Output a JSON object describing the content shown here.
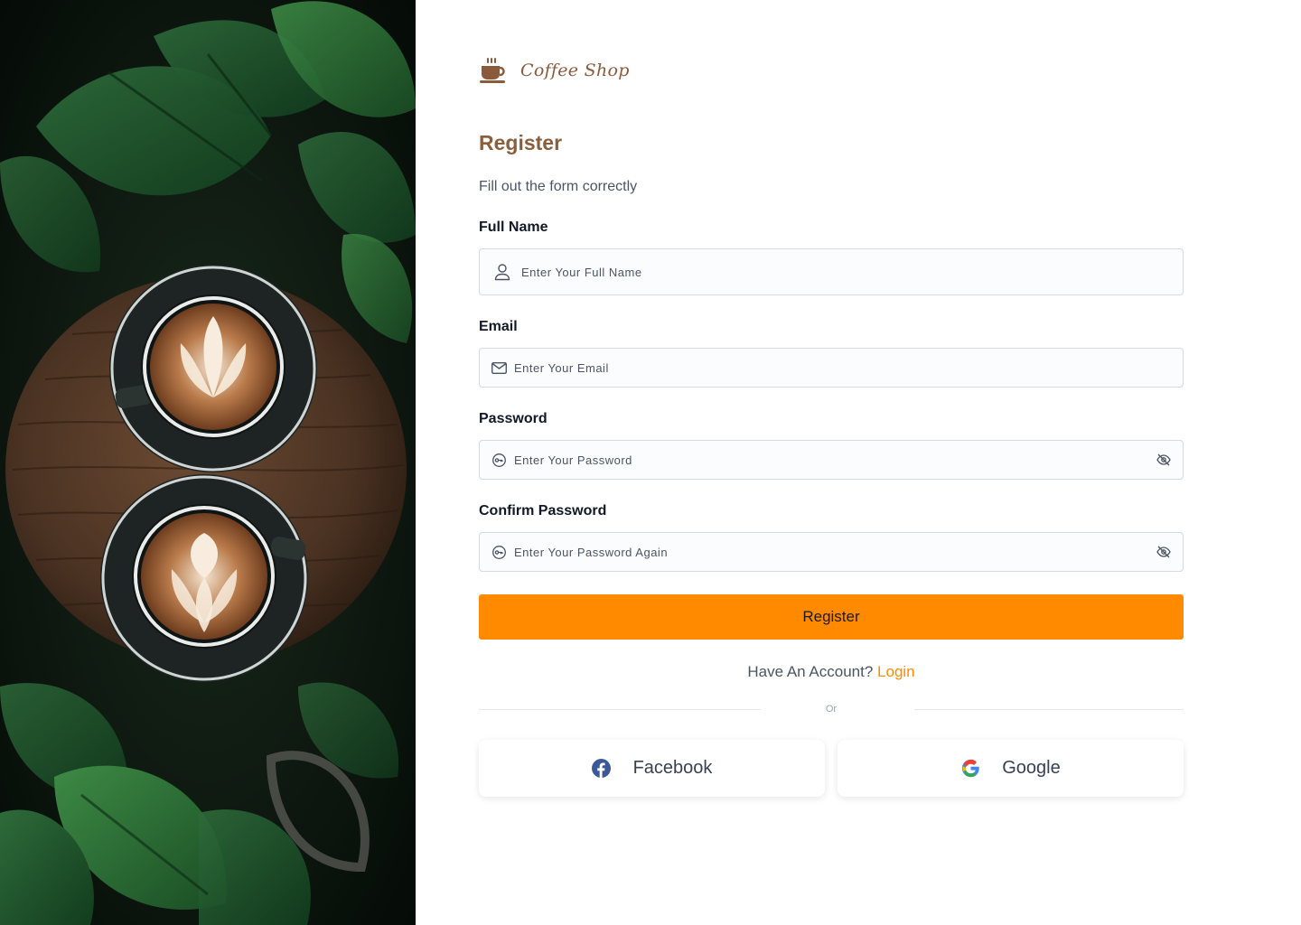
{
  "brand": {
    "name": "Coffee Shop",
    "icon": "coffee-cup-icon",
    "color": "#8a5a3c"
  },
  "form": {
    "title": "Register",
    "subtitle": "Fill out the form correctly",
    "fields": {
      "full_name": {
        "label": "Full Name",
        "placeholder": "Enter Your Full Name",
        "icon": "user-icon"
      },
      "email": {
        "label": "Email",
        "placeholder": "Enter Your Email",
        "icon": "mail-icon"
      },
      "password": {
        "label": "Password",
        "placeholder": "Enter Your Password",
        "icon": "key-icon",
        "toggle_icon": "eye-off-icon"
      },
      "confirm_password": {
        "label": "Confirm Password",
        "placeholder": "Enter Your Password Again",
        "icon": "key-icon",
        "toggle_icon": "eye-off-icon"
      }
    },
    "submit_label": "Register",
    "have_account_text": "Have An Account?",
    "login_link": "Login",
    "or_text": "Or"
  },
  "social": {
    "facebook": {
      "label": "Facebook",
      "icon": "facebook-icon"
    },
    "google": {
      "label": "Google",
      "icon": "google-icon"
    }
  },
  "colors": {
    "accent": "#ff8a00",
    "title": "#8b5e3c",
    "facebook": "#3b5998"
  }
}
